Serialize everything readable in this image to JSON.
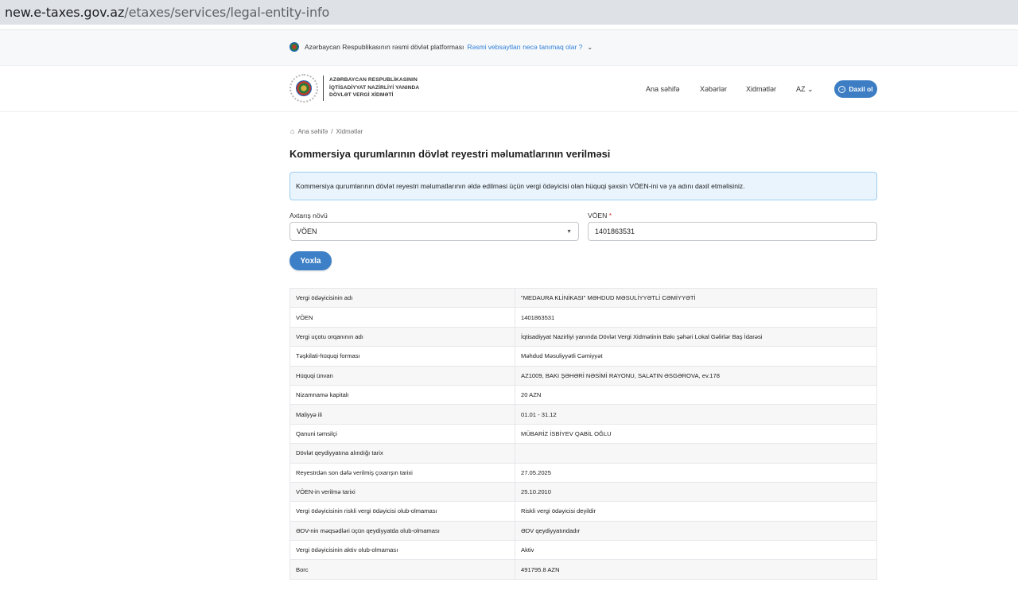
{
  "browser": {
    "url_host": "new.e-taxes.gov.az",
    "url_path": "/etaxes/services/legal-entity-info"
  },
  "govbar": {
    "text": "Azərbaycan Respublikasının rəsmi dövlət platforması",
    "link": "Rəsmi vebsaytları necə tanımaq olar ?",
    "chevron": "⌄"
  },
  "header": {
    "org_line1": "AZƏRBAYCAN RESPUBLİKASININ",
    "org_line2": "İQTİSADİYYAT NAZİRLİYİ YANINDA",
    "org_line3": "DÖVLƏT VERGİ XİDMƏTİ",
    "nav_home": "Ana səhifə",
    "nav_news": "Xəbərlər",
    "nav_services": "Xidmətlər",
    "nav_lang": "AZ",
    "login": "Daxil ol"
  },
  "breadcrumb": {
    "home": "Ana səhifə",
    "sep": "/",
    "current": "Xidmətlər"
  },
  "page_title": "Kommersiya qurumlarının dövlət reyestri məlumatlarının verilməsi",
  "info_text": "Kommersiya qurumlarının dövlət reyestri məlumatlarının əldə edilməsi üçün vergi ödəyicisi olan hüquqi şəxsin VÖEN-ini və ya adını daxil etməlisiniz.",
  "form": {
    "type_label": "Axtarış növü",
    "type_value": "VÖEN",
    "voen_label": "VÖEN",
    "voen_required": "*",
    "voen_value": "1401863531",
    "check_button": "Yoxla"
  },
  "table": [
    {
      "k": "Vergi ödəyicisinin adı",
      "v": "\"MEDAURA KLİNİKASI\" MƏHDUD MƏSULİYYƏTLİ CƏMİYYƏTİ"
    },
    {
      "k": "VÖEN",
      "v": "1401863531"
    },
    {
      "k": "Vergi uçotu orqanının adı",
      "v": "İqtisadiyyat Nazirliyi yanında Dövlət Vergi Xidmətinin Bakı şəhəri Lokal Gəlirlər Baş İdarəsi"
    },
    {
      "k": "Təşkilati-hüquqi forması",
      "v": "Məhdud Məsuliyyətli Cəmiyyət"
    },
    {
      "k": "Hüquqi ünvan",
      "v": "AZ1009, BAKI ŞƏHƏRİ NƏSİMİ RAYONU, SALATIN ƏSGƏROVA, ev.178"
    },
    {
      "k": "Nizamnamə kapitalı",
      "v": "20 AZN"
    },
    {
      "k": "Maliyyə ili",
      "v": "01.01 - 31.12"
    },
    {
      "k": "Qanuni təmsilçi",
      "v": "MÜBARİZ İSBİYEV QABİL OĞLU"
    },
    {
      "k": "Dövlət qeydiyyatına alındığı tarix",
      "v": ""
    },
    {
      "k": "Reyestrdən son dəfə verilmiş çıxarışın tarixi",
      "v": "27.05.2025"
    },
    {
      "k": "VÖEN-in verilmə tarixi",
      "v": "25.10.2010"
    },
    {
      "k": "Vergi ödəyicisinin riskli vergi ödəyicisi olub-olmaması",
      "v": "Riskli vergi ödəyicisi deyildir"
    },
    {
      "k": "ƏDV-nin məqsədləri üçün qeydiyyatda olub-olmaması",
      "v": "ƏDV qeydiyyatındadır"
    },
    {
      "k": "Vergi ödəyicisinin aktiv olub-olmaması",
      "v": "Aktiv"
    },
    {
      "k": "Borc",
      "v": "491795.8 AZN"
    }
  ]
}
